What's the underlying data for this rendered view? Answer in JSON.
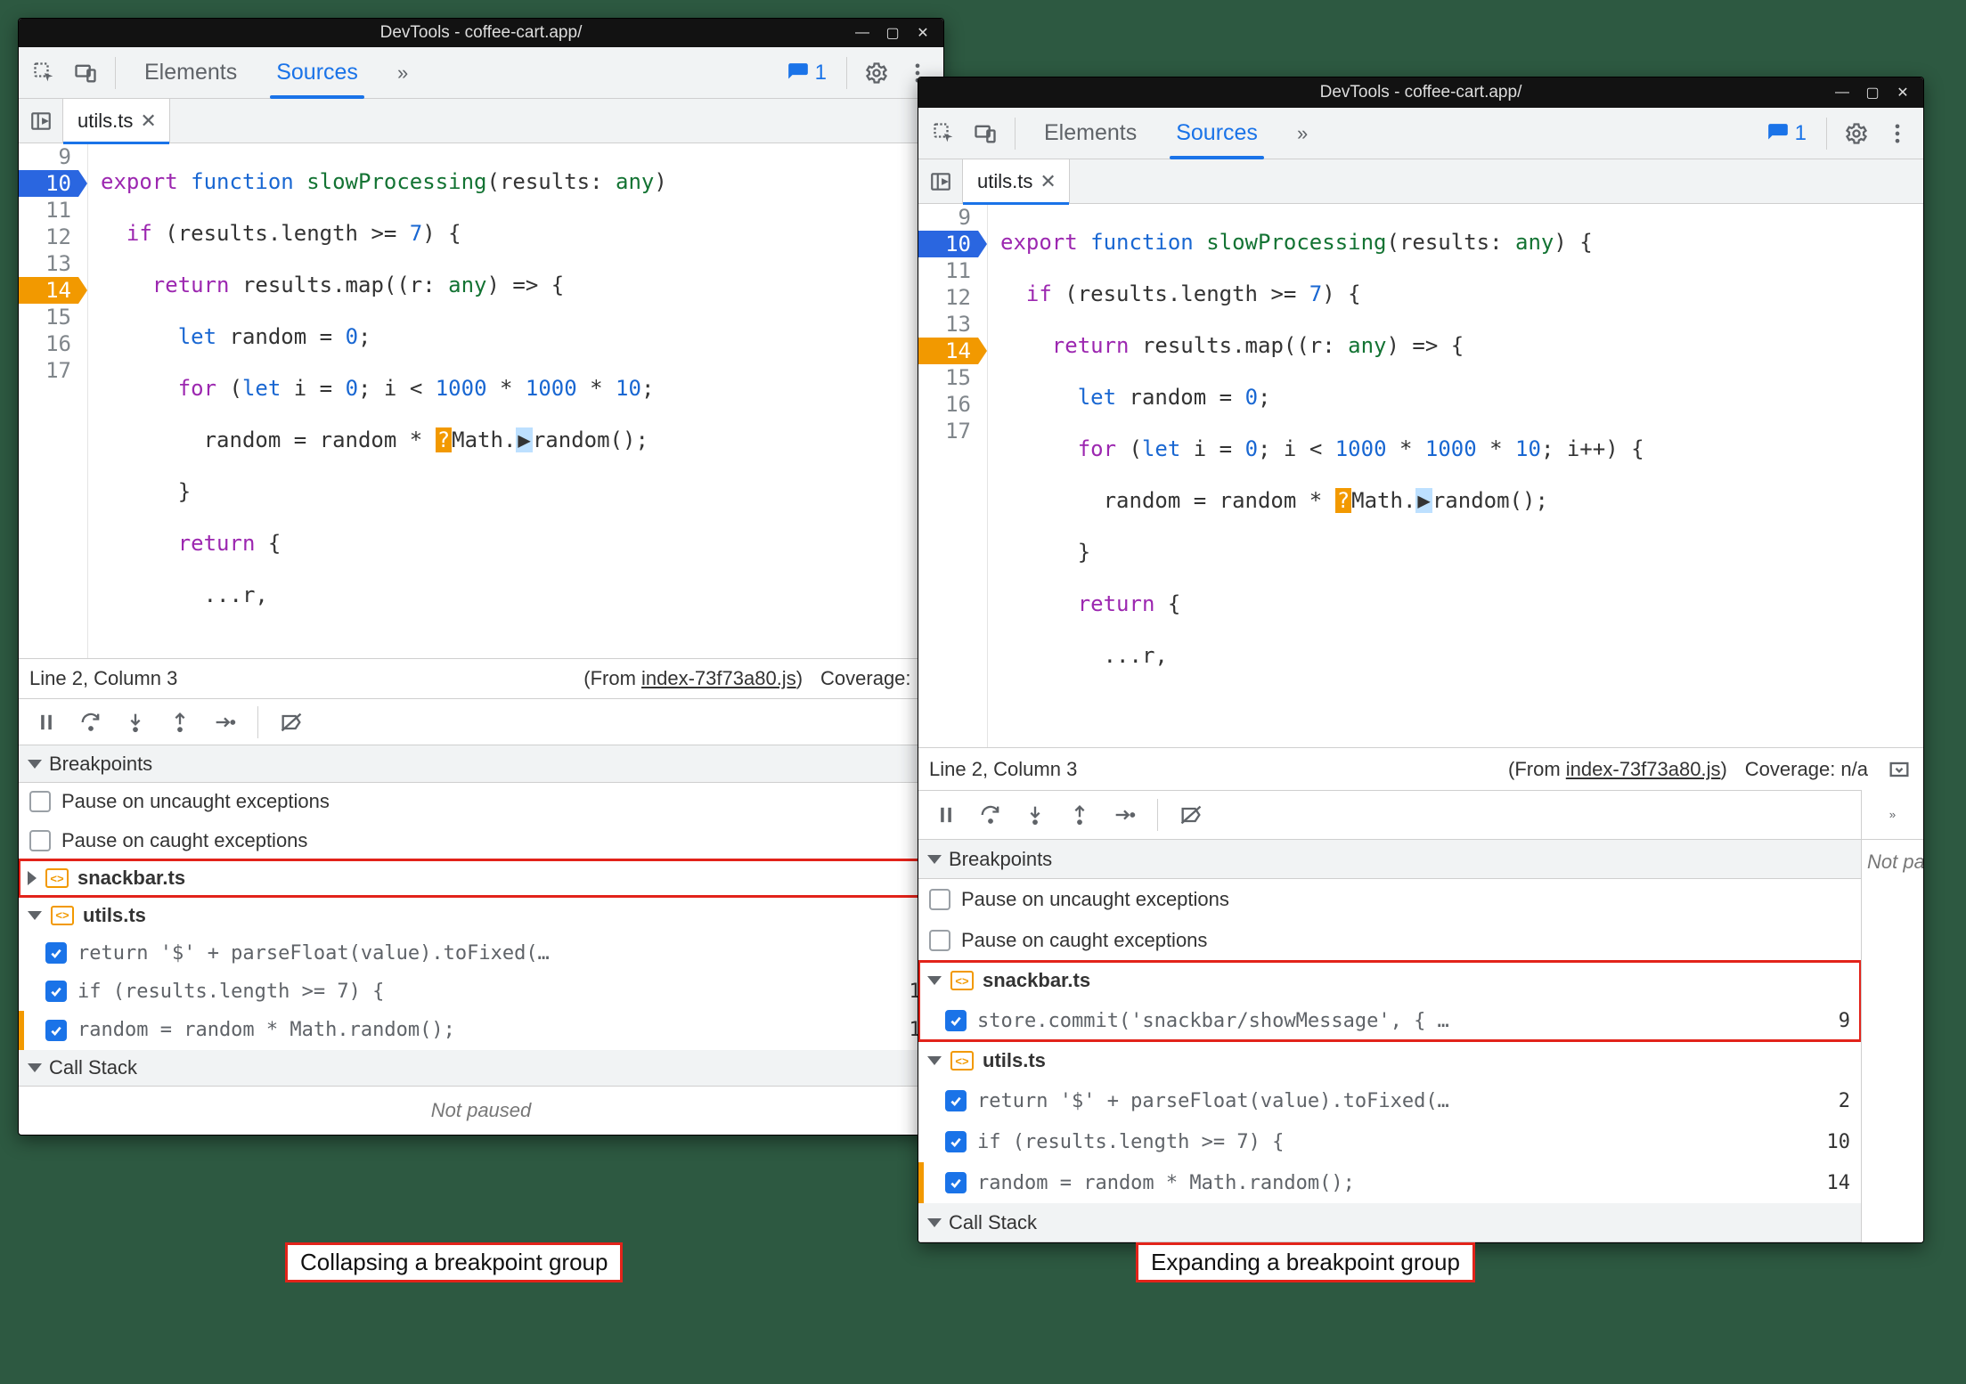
{
  "window_title": "DevTools - coffee-cart.app/",
  "tabs": {
    "elements": "Elements",
    "sources": "Sources",
    "more": ">>"
  },
  "issues_count": "1",
  "file_tab": "utils.ts",
  "status": {
    "linecol": "Line 2, Column 3",
    "from_prefix": "(From ",
    "from_link": "index-73f73a80.js",
    "from_suffix": ")",
    "coverage_left": "Coverage: n/",
    "coverage_right": "Coverage: n/a"
  },
  "sections": {
    "breakpoints": "Breakpoints",
    "callstack": "Call Stack",
    "notpaused": "Not paused"
  },
  "pause_uncaught": "Pause on uncaught exceptions",
  "pause_caught": "Pause on caught exceptions",
  "right_notpaused": "Not pa",
  "files": {
    "snackbar": "snackbar.ts",
    "utils": "utils.ts"
  },
  "bp_snackbar_item": {
    "text": "store.commit('snackbar/showMessage', { …",
    "line": "9"
  },
  "bp_utils_items": [
    {
      "text": "return '$' + parseFloat(value).toFixed(…",
      "line": "2"
    },
    {
      "text": "if (results.length >= 7) {",
      "line": "10"
    },
    {
      "text": "random = random * Math.random();",
      "line": "14"
    }
  ],
  "code_lines": [
    "9",
    "10",
    "11",
    "12",
    "13",
    "14",
    "15",
    "16",
    "17"
  ],
  "captions": {
    "left": "Collapsing a breakpoint group",
    "right": "Expanding a breakpoint group"
  }
}
